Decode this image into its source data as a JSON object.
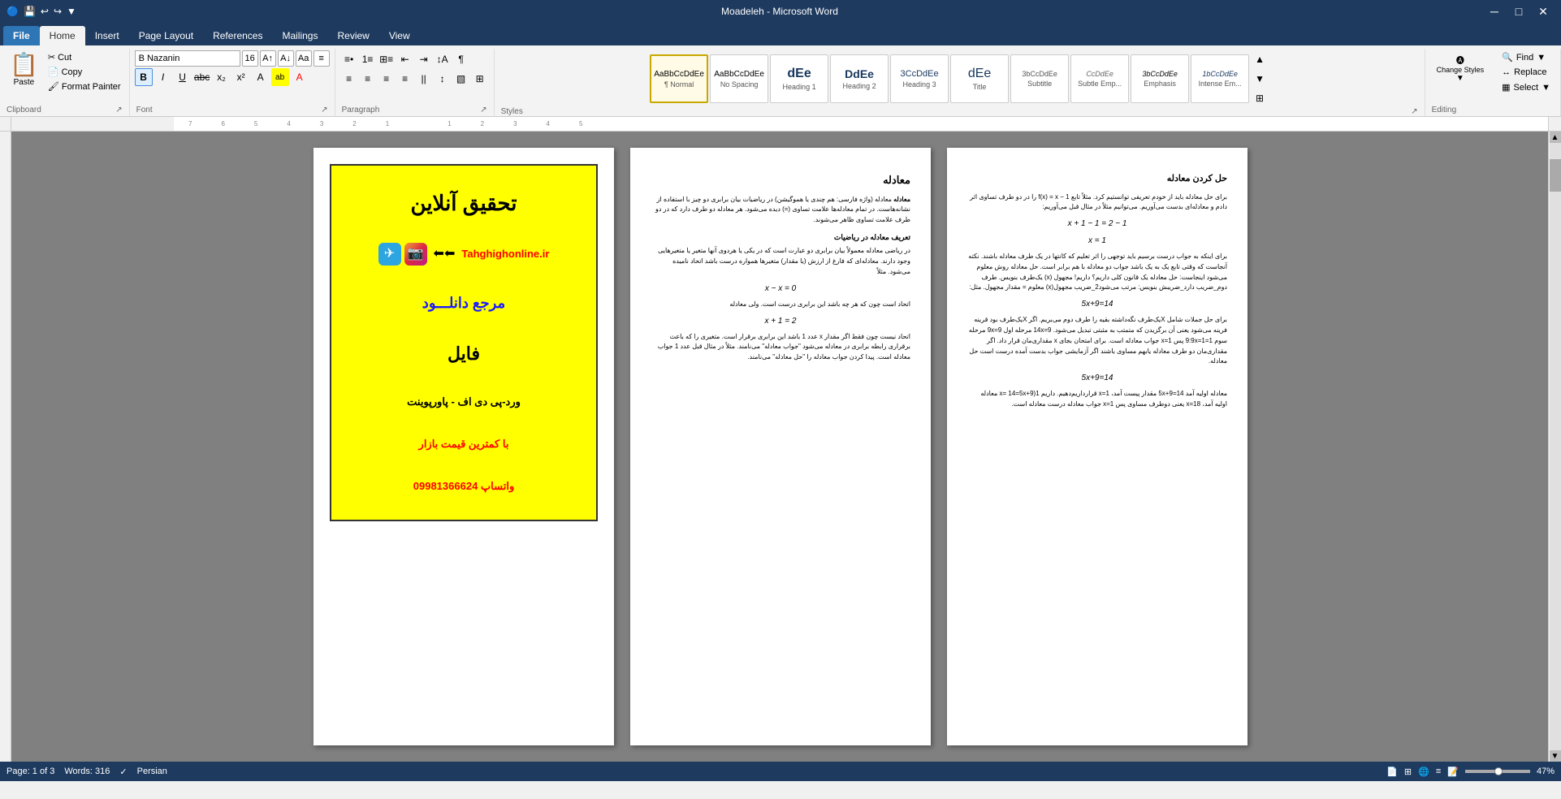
{
  "titleBar": {
    "title": "Moadeleh - Microsoft Word",
    "minimizeLabel": "─",
    "maximizeLabel": "□",
    "closeLabel": "✕"
  },
  "quickAccess": {
    "saveLabel": "💾",
    "undoLabel": "↩",
    "redoLabel": "↪",
    "moreLabel": "▼"
  },
  "ribbonTabs": {
    "file": "File",
    "home": "Home",
    "insert": "Insert",
    "pageLayout": "Page Layout",
    "references": "References",
    "mailings": "Mailings",
    "review": "Review",
    "view": "View"
  },
  "clipboard": {
    "pasteLabel": "Paste",
    "cutLabel": "Cut",
    "copyLabel": "Copy",
    "formatPainterLabel": "Format Painter",
    "groupLabel": "Clipboard"
  },
  "font": {
    "fontName": "B Nazanin",
    "fontSize": "16",
    "boldLabel": "B",
    "italicLabel": "I",
    "underlineLabel": "U",
    "groupLabel": "Font"
  },
  "paragraph": {
    "groupLabel": "Paragraph"
  },
  "styles": {
    "groupLabel": "Styles",
    "items": [
      {
        "id": "normal",
        "preview": "AaBbCcDdEe",
        "label": "Normal",
        "active": true
      },
      {
        "id": "no-spacing",
        "preview": "AaBbCcDdEe",
        "label": "No Spacing",
        "active": false
      },
      {
        "id": "heading1",
        "preview": "dEe",
        "label": "Heading 1",
        "active": false
      },
      {
        "id": "heading2",
        "preview": "DdEe",
        "label": "Heading 2",
        "active": false
      },
      {
        "id": "heading3",
        "preview": "3CcDdEe",
        "label": "Heading 3",
        "active": false
      },
      {
        "id": "title",
        "preview": "dEe",
        "label": "Title",
        "active": false
      },
      {
        "id": "subtitle",
        "preview": "3bCcDdEe",
        "label": "Subtitle",
        "active": false
      },
      {
        "id": "subtle-emph",
        "preview": "CcDdEe",
        "label": "Subtle Emp...",
        "active": false
      },
      {
        "id": "emphasis",
        "preview": "3bCcDdEe",
        "label": "Emphasis",
        "active": false
      },
      {
        "id": "intense-em",
        "preview": "1bCcDdEe",
        "label": "Intense Em...",
        "active": false
      }
    ]
  },
  "changeStyles": {
    "label": "Change Styles",
    "arrowLabel": "▼"
  },
  "editing": {
    "groupLabel": "Editing",
    "findLabel": "Find",
    "replaceLabel": "Replace",
    "selectLabel": "Select"
  },
  "pages": {
    "page1": {
      "title": "تحقیق آنلاین",
      "url": "Tahghighonline.ir",
      "arrowText": "←←",
      "subtitle": "مرجع دانلـــود",
      "products": "فایل\nورد-پی دی اف - پاورپوینت",
      "priceLine": "با کمترین قیمت بازار",
      "phone": "09981366624",
      "whatsapp": "واتساپ"
    },
    "page2": {
      "title": "معادله",
      "body": "معادله (واژه فارسی: هم چندی یا هموگیشن) در ریاضیات بیان برابری دو چیز با استفاده از نشانه‌هاست. در تمام معادله‌ها علامت تساوی (=) دیده می‌شود. هر معادله دو طرف دارد که در دو طرف علامت تساوی ظاهر می‌شوند.",
      "section1": "تعریف معادله در ریاضیات",
      "body2": "در ریاضی معادله معمولاً بیان برابری دو عبارت است که در یکی یا هردوی آنها متغیر یا متغیرهایی وجود دارند.\nمعادله‌ای که فارغ از ارزش (یا مقدار) متغیرها همواره درست باشد اتحاد نامیده می‌شود. مثلاً",
      "math1": "x − x = 0",
      "body3": "اتحاد است چون که هر چه باشد این برابری درست است. ولی معادله",
      "math2": "x + 1 = 2",
      "body4": "اتحاد نیست چون فقط اگر مقدار x عدد 1 باشد این برابری برقرار است. متغیری را که باعث برقراری رابطه برابری در معادله می‌شود \"جواب معادله\" می‌نامند. مثلاً در مثال قبل عدد 1 جواب معادله است. پیدا کردن جواب معادله را \"حل معادله\" می‌نامند."
    },
    "page3": {
      "title": "حل کردن معادله",
      "body": "برای حل معادله باید از خودم تعریفی توانستیم کرد. مثلاً تابع f(x) = x − 1 را در دو طرف تساوی اثر دادم و معادله‌ای بدست می‌آوریم. می‌توانیم مثلاً در مثال قبل می‌آوریم:",
      "math1": "x + 1 − 1 = 2 − 1",
      "math2": "x = 1",
      "body2": "برای اینکه به جواب درست برسیم باید توجهی را اثر تعلیم که کانتها در یک طرف معادله باشند. نکته آنجاست که وقتی تابع یک به یک باشد جواب دو معادله با هم برابر است. حل معادله روش معلوم می‌شود اینجاست: حل معادله یک قانون کلی داریم؟ داریم! مجهول (x) یک‌طرف بنویس. طرف دوم_ضریب دارد_ضریبش بنویس: مرتب می‌شود2_ضریب مجهول(x) معلوم = مقدار مجهول. مثل:",
      "math3": "5x+9=14",
      "body3": "برای حل جملات شامل Xیک‌طرف نگه‌داشته بقیه را طرف دوم می‌بریم. اگر Xیک‌طرف بود قرینه فرینه می‌شود یعنی آن برگزیدن که متمتب به مثبتی تبدیل می‌شود. 14x=9 مرحله اول 9x=9 مرحله سوم 1=9:9x=1 پس x=1 جواب معادله است. برای امتحان بجای x مقداری‌مان قرار داد. اگر مقداری‌مان دو طرف معادله یابهم مساوی باشند اگر آزمایشی جواب بدست آمده درست است حل معادله.",
      "math4": "5x+9=14",
      "body4": "معادله اولیه آمد 14=5x+9 مقدار پیست آمد، x=1 قرارداریم‌دهیم. داریم 1(x= 14=5x+9 معادله اولیه آمد، x=18 یعنی دوطرف مساوی پس x=1 جواب معادله درست معادله است."
    }
  },
  "statusBar": {
    "pageInfo": "Page: 1 of 3",
    "wordsLabel": "Words: 316",
    "language": "Persian",
    "zoom": "47%"
  }
}
